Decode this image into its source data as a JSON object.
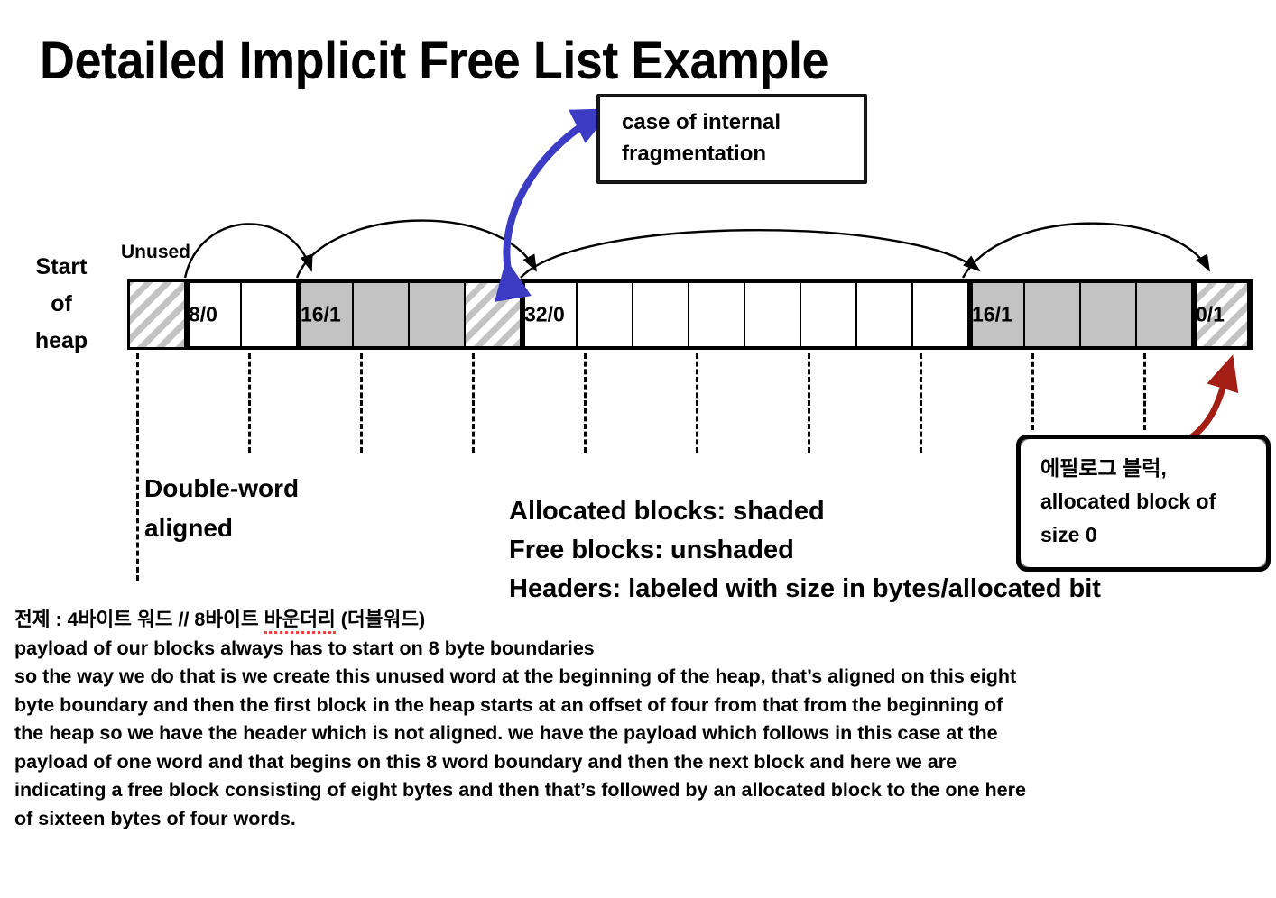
{
  "slide": {
    "title": "Detailed Implicit Free List Example"
  },
  "diagram": {
    "start_of_heap": [
      "Start",
      "of",
      "heap"
    ],
    "unused_label": "Unused",
    "blocks": [
      {
        "name": "unused-word",
        "header": "",
        "cells": 1,
        "style": "hatch",
        "outer_border": false
      },
      {
        "name": "free-block-8",
        "header": "8/0",
        "cells": 2,
        "style": "free",
        "outer_border": true
      },
      {
        "name": "allocated-block-16-a",
        "header": "16/1",
        "cells": 4,
        "style": "allocated-with-padding",
        "outer_border": true
      },
      {
        "name": "free-block-32",
        "header": "32/0",
        "cells": 8,
        "style": "free",
        "outer_border": true
      },
      {
        "name": "allocated-block-16-b",
        "header": "16/1",
        "cells": 4,
        "style": "allocated",
        "outer_border": true
      },
      {
        "name": "epilogue-block",
        "header": "0/1",
        "cells": 1,
        "style": "hatch",
        "outer_border": true
      }
    ],
    "cell_count_total": 20
  },
  "callouts": {
    "fragmentation": {
      "lines": [
        "case of internal",
        "fragmentation"
      ],
      "arrow_color": "#3b3bc4",
      "arrow_style": "double-headed-curved"
    },
    "epilogue": {
      "lines": [
        "에필로그 블럭,",
        "allocated block of",
        "size 0"
      ],
      "arrow_color": "#a31f16",
      "arrow_style": "double-headed-curved"
    }
  },
  "annotations": {
    "double_word_aligned": [
      "Double-word",
      "aligned"
    ],
    "legend": [
      "Allocated blocks: shaded",
      "Free blocks: unshaded",
      "Headers: labeled with size in bytes/allocated bit"
    ]
  },
  "notes": {
    "korean_prefix": "전제 : 4바이트 워드 // 8바이트 ",
    "korean_misspelled": "바운더리",
    "korean_suffix": " (더블워드)",
    "lines": [
      "payload of our blocks always has to start on 8 byte boundaries",
      "so the way we do that is we create this unused word at the beginning of the heap, that’s aligned on this eight",
      "byte boundary and then the first block in the heap starts at an offset of four from that from the beginning of",
      "the heap so we have the header which is not aligned. we have the payload which follows in this case at the",
      "payload of one word and that begins on this 8 word boundary and then the next block and here we are",
      "indicating a free block consisting of eight bytes and then that’s followed by an allocated block to the one here",
      "of sixteen bytes of four words."
    ]
  },
  "colors": {
    "shaded": "#c3c3c3",
    "blue_arrow": "#3b3bc4",
    "red_arrow": "#a31f16",
    "spellcheck_underline": "#e8493a"
  }
}
